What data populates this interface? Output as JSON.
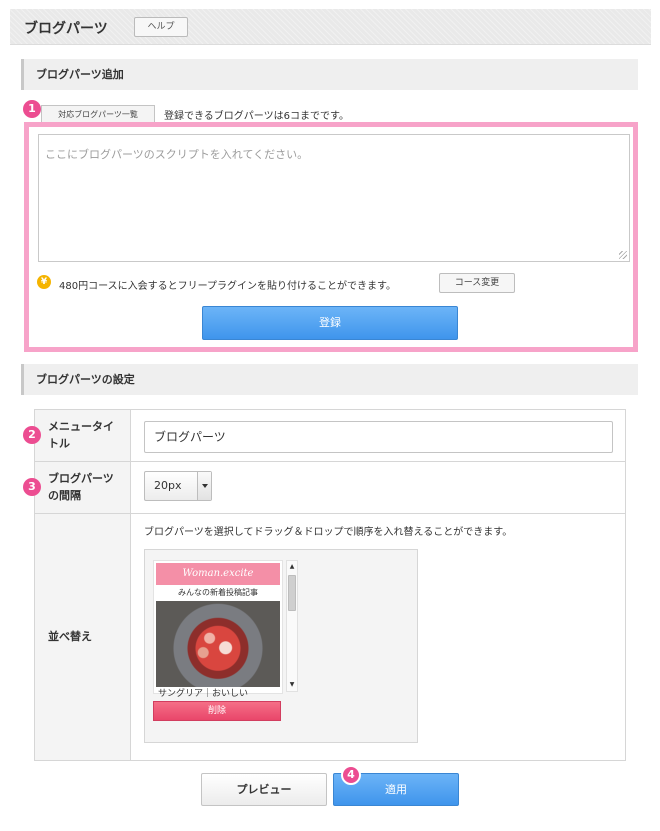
{
  "header": {
    "title": "ブログパーツ",
    "help_label": "ヘルプ"
  },
  "add_section": {
    "title": "ブログパーツ追加",
    "step": "1",
    "list_button": "対応ブログパーツ一覧",
    "limit_note": "登録できるブログパーツは6コまでです。",
    "script_placeholder": "ここにブログパーツのスクリプトを入れてください。",
    "yen_icon": "¥",
    "course_note": "480円コースに入会するとフリープラグインを貼り付けることができます。",
    "course_button": "コース変更",
    "register_button": "登録"
  },
  "settings_section": {
    "title": "ブログパーツの設定",
    "menu_title": {
      "step": "2",
      "label": "メニュータイトル",
      "value": "ブログパーツ"
    },
    "spacing": {
      "step": "3",
      "label": "ブログパーツの間隔",
      "value": "20px"
    },
    "sort": {
      "label": "並べ替え",
      "note": "ブログパーツを選択してドラッグ＆ドロップで順序を入れ替えることができます。",
      "part": {
        "banner": "Woman.excite",
        "subtitle": "みんなの新着投稿記事",
        "caption": "サングリア｜おいしい"
      },
      "delete_button": "削除"
    }
  },
  "footer": {
    "preview_button": "プレビュー",
    "apply_button": "適用",
    "apply_step": "4"
  },
  "colors": {
    "accent_pink": "#ec4d91",
    "primary_blue": "#4a9df0",
    "delete_red": "#ee5573",
    "highlight_border": "#f7a3c9"
  }
}
